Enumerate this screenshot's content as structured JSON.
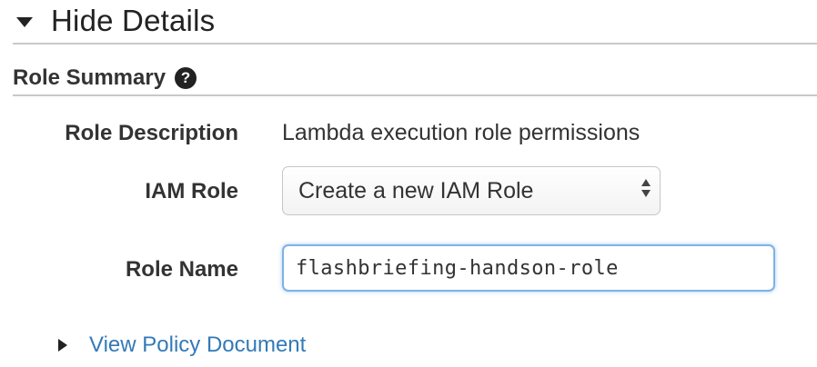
{
  "details": {
    "toggle_label": "Hide Details",
    "toggle_icon": "triangle-down-icon"
  },
  "role_summary": {
    "title": "Role Summary",
    "help_icon": "?"
  },
  "form": {
    "role_description": {
      "label": "Role Description",
      "value": "Lambda execution role permissions"
    },
    "iam_role": {
      "label": "IAM Role",
      "selected": "Create a new IAM Role"
    },
    "role_name": {
      "label": "Role Name",
      "value": "flashbriefing-handson-role"
    }
  },
  "policy_link": {
    "label": "View Policy Document",
    "icon": "triangle-right-icon",
    "color": "#337ab7"
  },
  "colors": {
    "link": "#337ab7",
    "focus_border": "#7fb2e5",
    "rule": "#c9c9c9"
  }
}
